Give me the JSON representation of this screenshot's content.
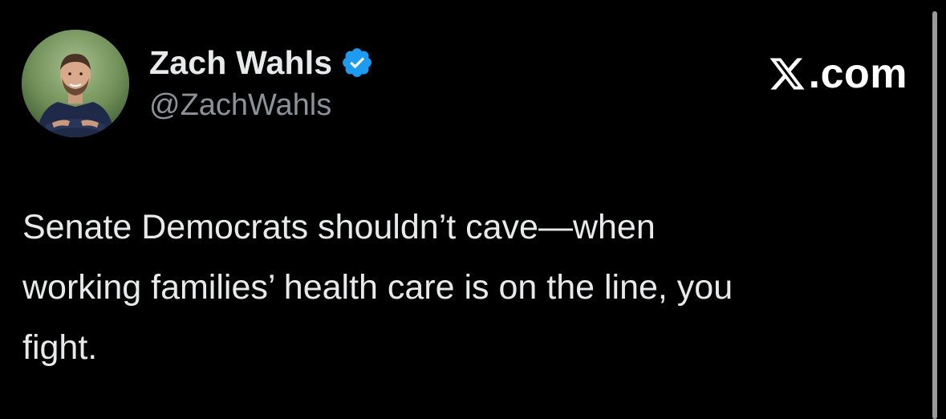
{
  "author": {
    "display_name": "Zach Wahls",
    "handle": "@ZachWahls",
    "verified": true,
    "avatar_icon": "profile-photo"
  },
  "brand": {
    "label": ".com",
    "icon": "x-logo-icon"
  },
  "tweet": {
    "text": "Senate Democrats shouldn’t cave—when\nworking families’ health care is on the line, you\nfight."
  },
  "colors": {
    "background": "#000000",
    "text": "#e7e9ea",
    "handle": "#8b9299",
    "verified_badge": "#1d9bf0"
  }
}
